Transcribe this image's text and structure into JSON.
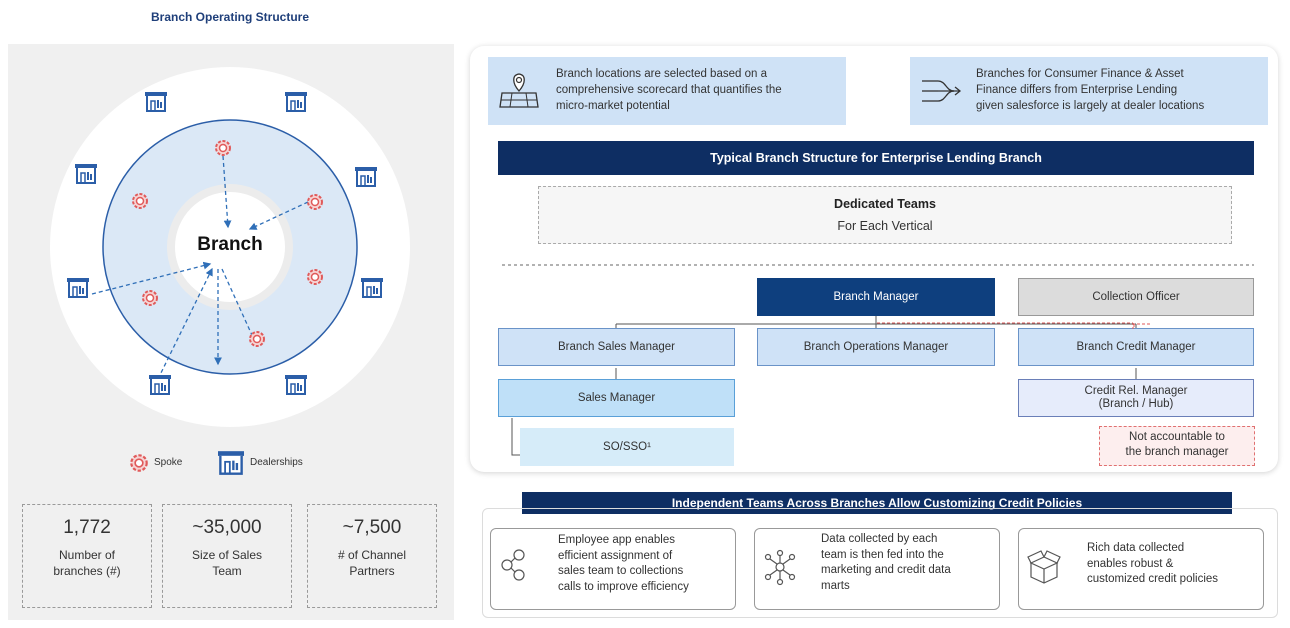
{
  "left": {
    "title": "Branch Operating Structure",
    "center_label": "Branch",
    "legend": {
      "spoke": "Spoke",
      "dealerships": "Dealerships"
    },
    "stats": [
      {
        "value": "1,772",
        "label_line1": "Number of",
        "label_line2": "branches (#)"
      },
      {
        "value": "~35,000",
        "label_line1": "Size of Sales",
        "label_line2": "Team"
      },
      {
        "value": "~7,500",
        "label_line1": "# of Channel",
        "label_line2": "Partners"
      }
    ]
  },
  "info": {
    "box1": [
      "Branch locations are selected based on a",
      "comprehensive scorecard that quantifies the",
      "micro-market potential"
    ],
    "box2": [
      "Branches for Consumer Finance & Asset",
      "Finance differs from Enterprise Lending",
      "given salesforce is largely at dealer locations"
    ]
  },
  "structure": {
    "title": "Typical Branch Structure for Enterprise Lending Branch",
    "dedicated_title": "Dedicated Teams",
    "dedicated_sub": "For Each Vertical",
    "roles": {
      "branch_manager": "Branch Manager",
      "collection_officer": "Collection Officer",
      "branch_sales_manager": "Branch Sales Manager",
      "branch_operations_manager": "Branch Operations Manager",
      "branch_credit_manager": "Branch Credit Manager",
      "sales_manager": "Sales Manager",
      "credit_rel_manager_line1": "Credit Rel. Manager",
      "credit_rel_manager_line2": "(Branch / Hub)",
      "so_sso": "SO/SSO¹"
    },
    "note_line1": "Not accountable to",
    "note_line2": "the branch manager"
  },
  "independent": {
    "title": "Independent Teams Across Branches Allow Customizing Credit Policies",
    "features": [
      {
        "icon": "people-network-icon",
        "lines": [
          "Employee app enables",
          "efficient assignment of",
          "sales team to collections",
          "calls to improve efficiency"
        ]
      },
      {
        "icon": "data-flow-icon",
        "lines": [
          "Data collected by each",
          "team is then fed into the",
          "marketing and credit data",
          "marts"
        ]
      },
      {
        "icon": "boxes-icon",
        "lines": [
          "Rich data collected",
          "enables robust &",
          "customized credit policies"
        ]
      }
    ]
  },
  "colors": {
    "navy": "#0e2e63",
    "light_blue": "#cfe2f6",
    "ring_blue": "#2b5ea8",
    "spoke_red": "#e05a5a",
    "arrow_blue": "#2f6fb8"
  }
}
